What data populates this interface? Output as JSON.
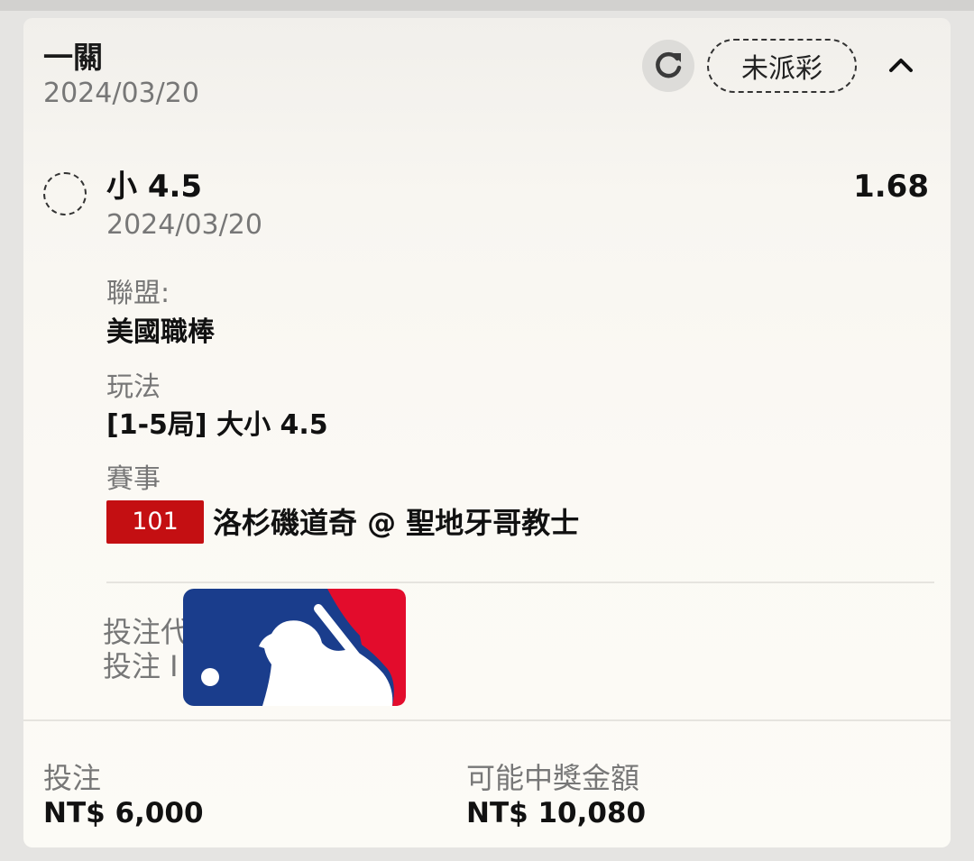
{
  "header": {
    "title": "一關",
    "date": "2024/03/20",
    "status": "未派彩"
  },
  "selection": {
    "name": "小 4.5",
    "odds": "1.68",
    "date": "2024/03/20"
  },
  "details": {
    "league_label": "聯盟:",
    "league_value": "美國職棒",
    "play_label": "玩法",
    "play_value": "[1-5局] 大小 4.5",
    "event_label": "賽事",
    "event_number": "101",
    "event_name": "洛杉磯道奇 @ 聖地牙哥教士"
  },
  "meta": {
    "line1": "投注代",
    "line2": "投注 I"
  },
  "footer": {
    "stake_label": "投注",
    "stake_value": "NT$ 6,000",
    "payout_label": "可能中獎金額",
    "payout_value": "NT$ 10,080"
  },
  "colors": {
    "badge_red": "#c40f12",
    "mlb_blue": "#1a3d8c",
    "mlb_red": "#e30c2c"
  },
  "icons": {
    "refresh": "refresh-icon",
    "collapse": "chevron-up-icon",
    "logo": "mlb-logo"
  }
}
